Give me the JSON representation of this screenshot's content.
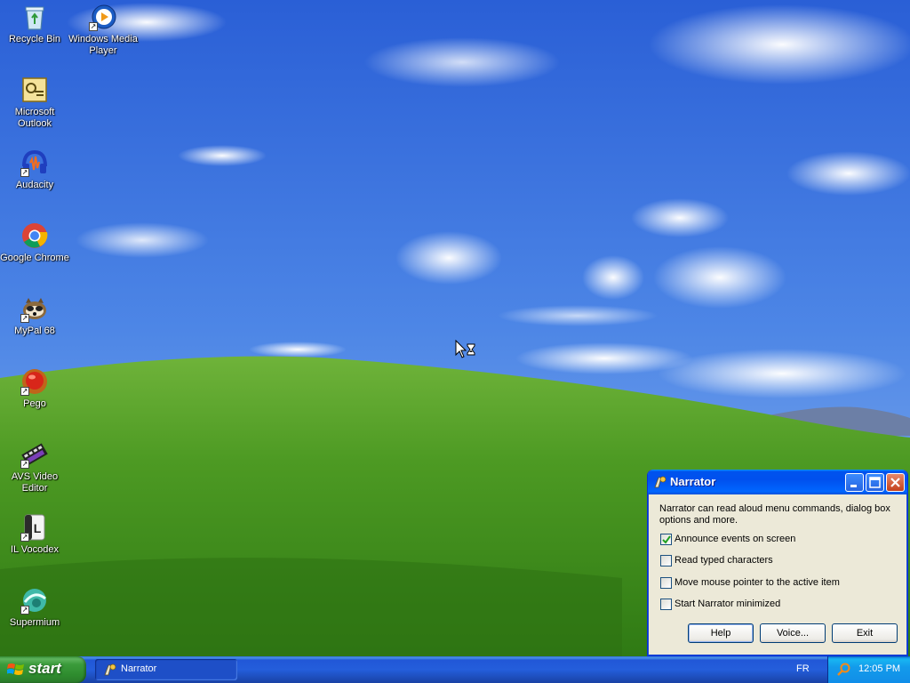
{
  "desktop": {
    "icons": [
      {
        "label": "Recycle Bin",
        "icon": "recycle-bin-icon"
      },
      {
        "label": "Windows Media Player",
        "icon": "windows-media-player-icon"
      },
      {
        "label": "Microsoft Outlook",
        "icon": "outlook-icon"
      },
      {
        "label": "Audacity",
        "icon": "audacity-icon"
      },
      {
        "label": "Google Chrome",
        "icon": "chrome-icon"
      },
      {
        "label": "MyPal 68",
        "icon": "mypal-icon"
      },
      {
        "label": "Pego",
        "icon": "pego-icon"
      },
      {
        "label": "AVS Video Editor",
        "icon": "avs-video-editor-icon"
      },
      {
        "label": "IL Vocodex",
        "icon": "il-vocodex-icon"
      },
      {
        "label": "Supermium",
        "icon": "supermium-icon"
      }
    ]
  },
  "narrator": {
    "title": "Narrator",
    "description": "Narrator can read aloud menu commands, dialog box options and more.",
    "options": [
      {
        "label": "Announce events on screen",
        "checked": true
      },
      {
        "label": "Read typed characters",
        "checked": false
      },
      {
        "label": "Move mouse pointer to the active item",
        "checked": false
      },
      {
        "label": "Start Narrator minimized",
        "checked": false
      }
    ],
    "buttons": {
      "help": "Help",
      "voice": "Voice...",
      "exit": "Exit"
    }
  },
  "taskbar": {
    "start_label": "start",
    "tasks": [
      {
        "label": "Narrator"
      }
    ],
    "language": "FR",
    "clock": "12:05 PM"
  },
  "colors": {
    "titlebar_blue": "#0053ee",
    "start_green": "#3b9b3b",
    "window_face": "#ece9d8"
  }
}
